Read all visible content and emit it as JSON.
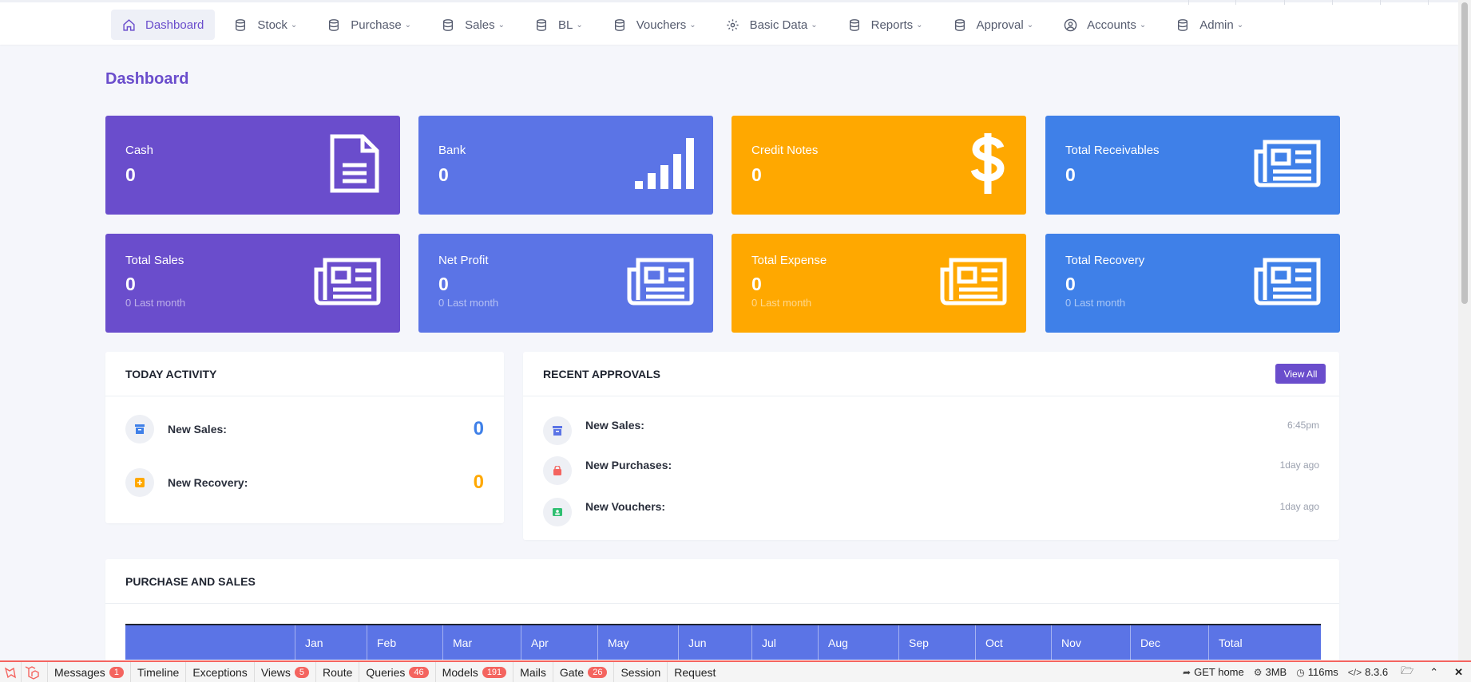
{
  "nav": {
    "items": [
      {
        "label": "Dashboard",
        "icon": "home-icon",
        "active": true
      },
      {
        "label": "Stock",
        "icon": "database-icon"
      },
      {
        "label": "Purchase",
        "icon": "database-icon"
      },
      {
        "label": "Sales",
        "icon": "database-icon"
      },
      {
        "label": "BL",
        "icon": "database-icon"
      },
      {
        "label": "Vouchers",
        "icon": "database-icon"
      },
      {
        "label": "Basic Data",
        "icon": "gear-icon"
      },
      {
        "label": "Reports",
        "icon": "database-icon"
      },
      {
        "label": "Approval",
        "icon": "database-icon"
      },
      {
        "label": "Accounts",
        "icon": "user-circle-icon"
      },
      {
        "label": "Admin",
        "icon": "database-icon"
      }
    ]
  },
  "page": {
    "title": "Dashboard"
  },
  "stats": {
    "cash": {
      "label": "Cash",
      "value": "0",
      "icon": "document-icon",
      "color": "#6a4dcc"
    },
    "bank": {
      "label": "Bank",
      "value": "0",
      "icon": "signal-bars-icon",
      "color": "#5b74e6"
    },
    "credit": {
      "label": "Credit Notes",
      "value": "0",
      "icon": "dollar-icon",
      "color": "#ffa800"
    },
    "receivables": {
      "label": "Total Receivables",
      "value": "0",
      "icon": "newspaper-icon",
      "color": "#3f80e8"
    },
    "sales": {
      "label": "Total Sales",
      "value": "0",
      "sub": "0 Last month",
      "icon": "newspaper-icon"
    },
    "profit": {
      "label": "Net Profit",
      "value": "0",
      "sub": "0 Last month",
      "icon": "newspaper-icon"
    },
    "expense": {
      "label": "Total Expense",
      "value": "0",
      "sub": "0 Last month",
      "icon": "newspaper-icon"
    },
    "recovery": {
      "label": "Total Recovery",
      "value": "0",
      "sub": "0 Last month",
      "icon": "newspaper-icon"
    }
  },
  "today": {
    "title": "TODAY ACTIVITY",
    "rows": [
      {
        "label": "New Sales:",
        "value": "0",
        "color": "#3f80e8",
        "icon": "archive-icon"
      },
      {
        "label": "New Recovery:",
        "value": "0",
        "color": "#ffa800",
        "icon": "plus-square-icon"
      }
    ]
  },
  "approvals": {
    "title": "RECENT APPROVALS",
    "view_all": "View All",
    "rows": [
      {
        "label": "New Sales:",
        "time": "6:45pm",
        "icon": "archive-icon",
        "color": "#5b74e6"
      },
      {
        "label": "New Purchases:",
        "time": "1day ago",
        "icon": "shopping-bag-icon",
        "color": "#f4645f"
      },
      {
        "label": "New Vouchers:",
        "time": "1day ago",
        "icon": "contact-card-icon",
        "color": "#2fbf71"
      }
    ]
  },
  "purchase_sales": {
    "title": "PURCHASE AND SALES",
    "columns": [
      "",
      "Jan",
      "Feb",
      "Mar",
      "Apr",
      "May",
      "Jun",
      "Jul",
      "Aug",
      "Sep",
      "Oct",
      "Nov",
      "Dec",
      "Total"
    ]
  },
  "debugbar": {
    "tabs": [
      {
        "label": "Messages",
        "badge": "1"
      },
      {
        "label": "Timeline"
      },
      {
        "label": "Exceptions"
      },
      {
        "label": "Views",
        "badge": "5"
      },
      {
        "label": "Route"
      },
      {
        "label": "Queries",
        "badge": "46"
      },
      {
        "label": "Models",
        "badge": "191"
      },
      {
        "label": "Mails"
      },
      {
        "label": "Gate",
        "badge": "26"
      },
      {
        "label": "Session"
      },
      {
        "label": "Request"
      }
    ],
    "route": "GET home",
    "memory": "3MB",
    "time": "116ms",
    "php": "8.3.6"
  }
}
